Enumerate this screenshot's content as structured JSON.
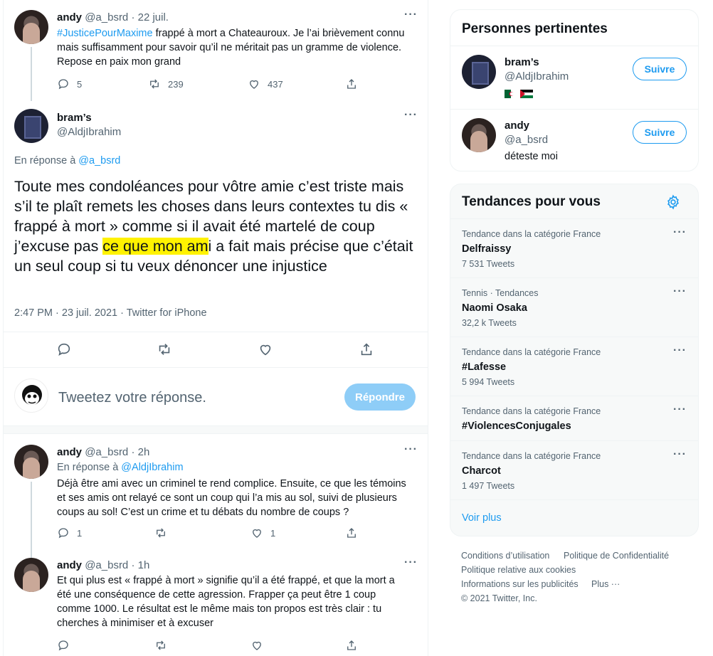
{
  "tweets": {
    "first": {
      "name": "andy",
      "handle_time": "@a_bsrd · 22 juil.",
      "hashtag": "#JusticePourMaxime",
      "text_line1": " frappé à mort a Chateauroux. Je l’ai brièvement connu",
      "text_line2": "mais suffisamment pour savoir qu’il ne méritait pas un gramme de violence.",
      "text_line3": "Repose en paix mon grand",
      "replies": "5",
      "retweets": "239",
      "likes": "437"
    },
    "main": {
      "name": "bram’s",
      "handle": "@AldjIbrahim",
      "reply_prefix": "En réponse à ",
      "reply_handle": "@a_bsrd",
      "text_before": "Toute mes condoléances pour vôtre amie c’est triste mais s’il te plaît remets les choses dans leurs contextes tu dis « frappé à mort » comme si il avait été martelé de coup j’excuse pas ",
      "text_highlight": "ce que mon am",
      "text_after": "i a fait mais précise que c’était un seul coup si tu veux dénoncer une injustice",
      "timestamp": "2:47 PM · 23 juil. 2021 · Twitter for iPhone"
    },
    "composer": {
      "placeholder": "Tweetez votre réponse.",
      "button": "Répondre"
    },
    "reply1": {
      "name": "andy",
      "handle_time": "@a_bsrd · 2h",
      "reply_prefix": "En réponse à ",
      "reply_handle": "@AldjIbrahim",
      "line1": "Déjà être ami avec un criminel te rend complice. Ensuite, ce que les témoins",
      "line2": "et ses amis ont relayé ce sont un coup qui l’a mis au sol, suivi de plusieurs",
      "line3": "coups au sol! C’est un crime et tu débats du nombre de coups ?",
      "replies": "1",
      "likes": "1"
    },
    "reply2": {
      "name": "andy",
      "handle_time": "@a_bsrd · 1h",
      "line1": "Et qui plus est « frappé à mort » signifie qu’il a été frappé, et que la mort a",
      "line2": "été une conséquence de cette agression. Frapper ça peut être 1 coup",
      "line3": "comme 1000. Le résultat est le même mais ton propos est très clair : tu",
      "line4": "cherches à minimiser et à excuser"
    }
  },
  "sidebar": {
    "people_title": "Personnes pertinentes",
    "people": [
      {
        "name": "bram’s",
        "handle": "@AldjIbrahim",
        "bio": "",
        "follow": "Suivre"
      },
      {
        "name": "andy",
        "handle": "@a_bsrd",
        "bio": "déteste moi",
        "follow": "Suivre"
      }
    ],
    "trends_title": "Tendances pour vous",
    "trends": [
      {
        "category": "Tendance dans la catégorie France",
        "name": "Delfraissy",
        "count": "7 531 Tweets"
      },
      {
        "category": "Tennis · Tendances",
        "name": "Naomi Osaka",
        "count": "32,2 k Tweets"
      },
      {
        "category": "Tendance dans la catégorie France",
        "name": "#Lafesse",
        "count": "5 994 Tweets"
      },
      {
        "category": "Tendance dans la catégorie France",
        "name": "#ViolencesConjugales",
        "count": ""
      },
      {
        "category": "Tendance dans la catégorie France",
        "name": "Charcot",
        "count": "1 497 Tweets"
      }
    ],
    "show_more": "Voir plus",
    "footer": {
      "terms": "Conditions d’utilisation",
      "privacy": "Politique de Confidentialité",
      "cookies": "Politique relative aux cookies",
      "ads": "Informations sur les publicités",
      "more": "Plus ···",
      "copyright": "© 2021 Twitter, Inc."
    }
  },
  "colors": {
    "accent": "#1d9bf0",
    "muted": "#536471",
    "highlight": "#fff200"
  }
}
